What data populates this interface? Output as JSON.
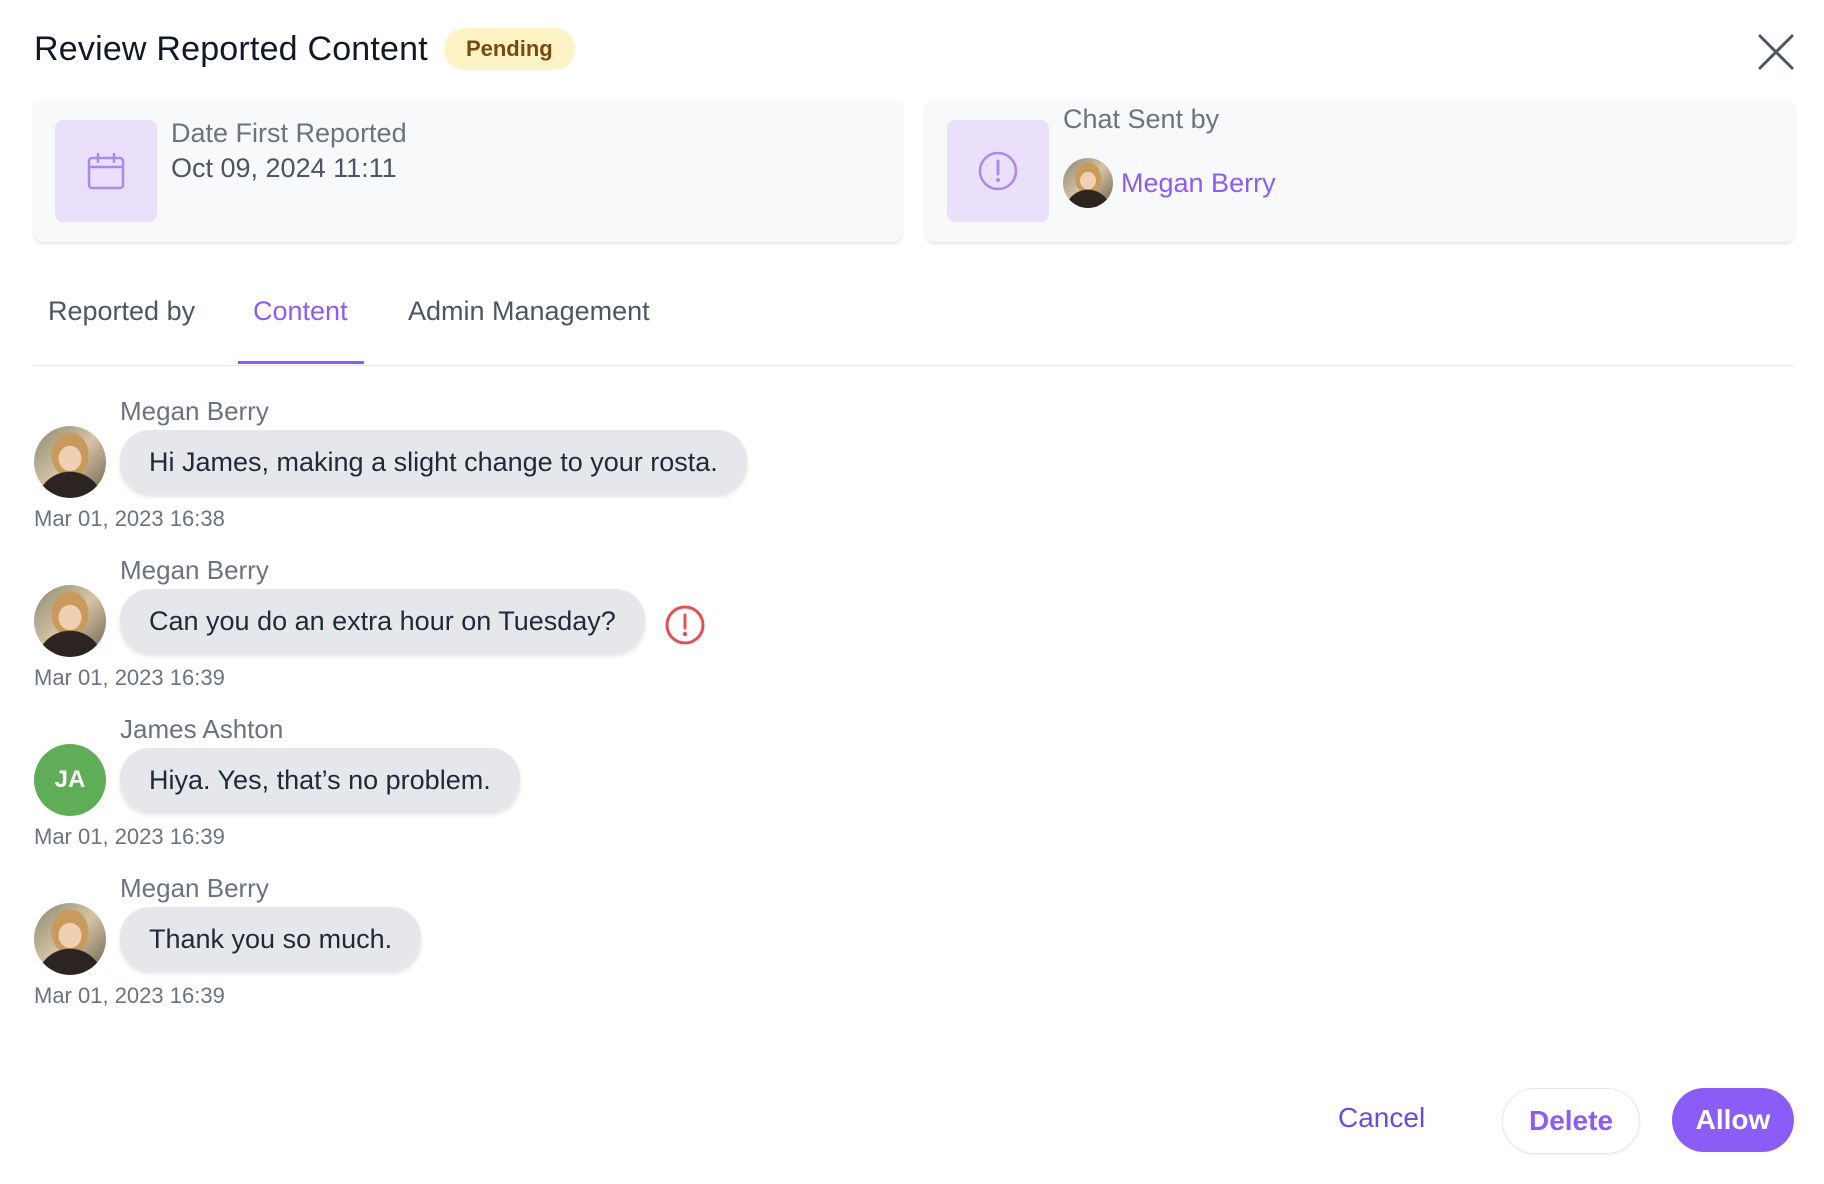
{
  "header": {
    "title": "Review Reported Content",
    "status_badge": "Pending"
  },
  "info_cards": {
    "date": {
      "label": "Date First Reported",
      "value": "Oct 09, 2024 11:11",
      "icon": "calendar-icon"
    },
    "sender": {
      "label": "Chat Sent by",
      "name": "Megan Berry",
      "icon": "alert-circle-icon"
    }
  },
  "tabs": [
    {
      "label": "Reported by",
      "active": false
    },
    {
      "label": "Content",
      "active": true
    },
    {
      "label": "Admin Management",
      "active": false
    }
  ],
  "messages": [
    {
      "sender": "Megan Berry",
      "text": "Hi James, making a slight change to your rosta.",
      "time": "Mar 01, 2023 16:38",
      "avatar": "photo",
      "flagged": false
    },
    {
      "sender": "Megan Berry",
      "text": "Can you do an extra hour on Tuesday?",
      "time": "Mar 01, 2023 16:39",
      "avatar": "photo",
      "flagged": true
    },
    {
      "sender": "James Ashton",
      "text": "Hiya. Yes, that’s no problem.",
      "time": "Mar 01, 2023 16:39",
      "avatar": "initials",
      "initials": "JA",
      "flagged": false
    },
    {
      "sender": "Megan Berry",
      "text": "Thank you so much.",
      "time": "Mar 01, 2023 16:39",
      "avatar": "photo",
      "flagged": false
    }
  ],
  "footer": {
    "cancel_label": "Cancel",
    "delete_label": "Delete",
    "allow_label": "Allow"
  },
  "colors": {
    "accent": "#8b5cf6",
    "badge_bg": "#fdf3c4",
    "badge_text": "#7a4a14",
    "flag": "#e05252",
    "initials_bg": "#5fad56"
  }
}
